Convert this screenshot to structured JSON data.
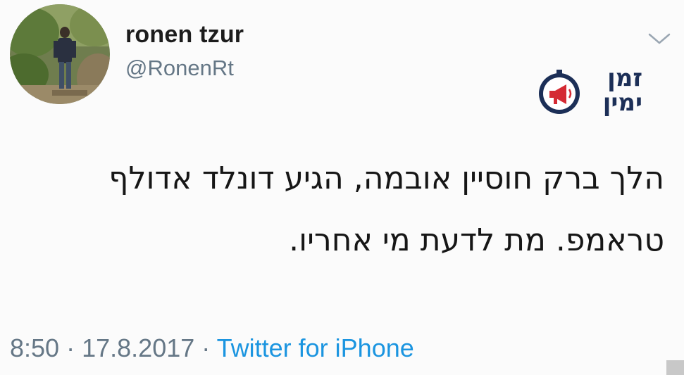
{
  "tweet": {
    "author": {
      "name": "ronen tzur",
      "handle": "@RonenRt",
      "avatar_icon": "profile-photo"
    },
    "text_lines": [
      "הלך ברק חוסיין אובמה, הגיע דונלד אדולף",
      "טראמפ. מת לדעת מי אחריו."
    ],
    "time": "8:50",
    "date": "17.8.2017",
    "separator": "·",
    "source": "Twitter for iPhone",
    "menu_icon": "chevron-down-icon"
  },
  "watermark": {
    "line1": "זמן",
    "line2": "ימין",
    "icon": "megaphone-clock-icon",
    "colors": {
      "navy": "#1c2f57",
      "red": "#d42a33"
    }
  },
  "colors": {
    "name": "#1c1c1c",
    "secondary": "#657786",
    "link": "#1b95e0"
  }
}
